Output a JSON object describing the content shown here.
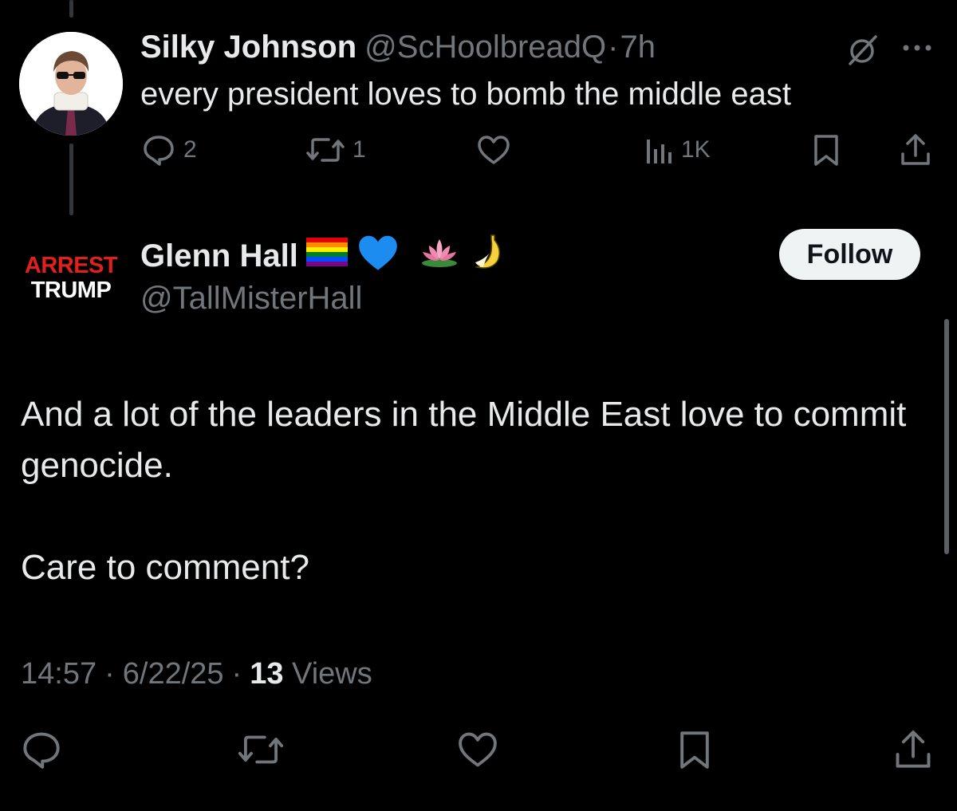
{
  "parent_tweet": {
    "display_name": "Silky Johnson",
    "handle": "@ScHoolbreadQ",
    "separator": "·",
    "time": "7h",
    "text": "every president loves to bomb the middle east",
    "avatar_icon": "avatar-man-sunglasses",
    "actions": {
      "reply_count": "2",
      "retweet_count": "1",
      "like_count": "",
      "views_count": "1K"
    }
  },
  "reply_tweet": {
    "avatar_lines": [
      "ARREST",
      "TRUMP"
    ],
    "display_name": "Glenn Hall",
    "name_emojis": [
      "🏳️‍🌈",
      "💙",
      "🪷",
      "🍌"
    ],
    "handle": "@TallMisterHall",
    "follow_label": "Follow",
    "body": [
      "And a lot of the leaders in the Middle East love to commit genocide.",
      "Care to comment?"
    ],
    "meta": {
      "time": "14:57",
      "sep1": "·",
      "date": "6/22/25",
      "sep2": "·",
      "views_count": "13",
      "views_label": "Views"
    }
  },
  "colors": {
    "background": "#000000",
    "text": "#e7e9ea",
    "muted": "#71767b",
    "arrest_red": "#e0201c",
    "follow_bg": "#eff3f4"
  }
}
